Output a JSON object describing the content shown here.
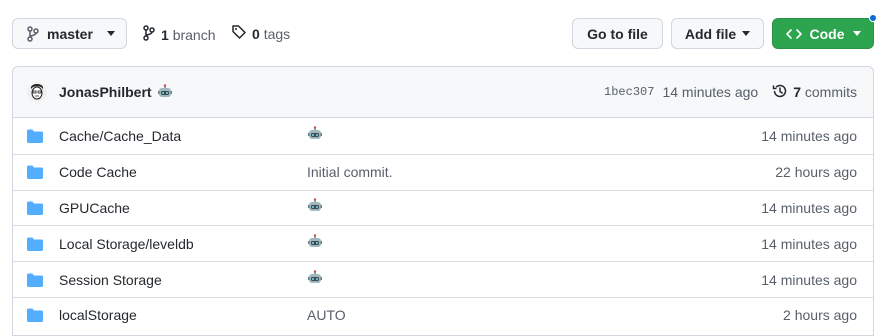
{
  "toolbar": {
    "branch_label": "master",
    "branches_count": "1",
    "branches_label": "branch",
    "tags_count": "0",
    "tags_label": "tags",
    "go_to_file_label": "Go to file",
    "add_file_label": "Add file",
    "code_label": "Code"
  },
  "commit": {
    "author": "JonasPhilbert",
    "sha": "1bec307",
    "age": "14 minutes ago",
    "commits_count": "7",
    "commits_label": "commits"
  },
  "files": [
    {
      "name": "Cache/Cache_Data",
      "message": "",
      "message_icon": "robot-emoji-icon",
      "age": "14 minutes ago"
    },
    {
      "name": "Code Cache",
      "message": "Initial commit.",
      "message_icon": "",
      "age": "22 hours ago"
    },
    {
      "name": "GPUCache",
      "message": "",
      "message_icon": "robot-emoji-icon",
      "age": "14 minutes ago"
    },
    {
      "name": "Local Storage/leveldb",
      "message": "",
      "message_icon": "robot-emoji-icon",
      "age": "14 minutes ago"
    },
    {
      "name": "Session Storage",
      "message": "",
      "message_icon": "robot-emoji-icon",
      "age": "14 minutes ago"
    },
    {
      "name": "localStorage",
      "message": "AUTO",
      "message_icon": "",
      "age": "2 hours ago"
    }
  ],
  "colors": {
    "folder": "#54aeff",
    "code_button": "#2da44e",
    "notification_dot": "#0969da"
  }
}
